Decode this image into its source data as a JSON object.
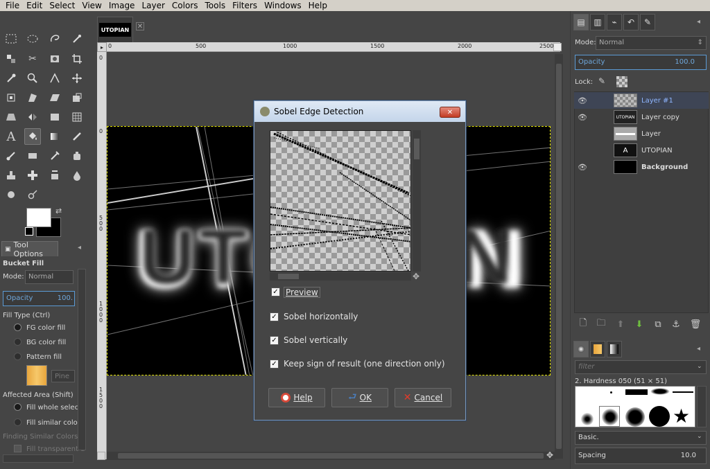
{
  "menubar": {
    "items": [
      "File",
      "Edit",
      "Select",
      "View",
      "Image",
      "Layer",
      "Colors",
      "Tools",
      "Filters",
      "Windows",
      "Help"
    ]
  },
  "image_tab": {
    "thumb_text": "UTOPIAN",
    "close": "✕"
  },
  "rulers": {
    "h_ticks": [
      "0",
      "500",
      "1000",
      "1500",
      "2000",
      "2500"
    ],
    "v_ticks": [
      "0",
      "500",
      "1000",
      "1500"
    ]
  },
  "canvas": {
    "image_text": "UTOPIAN",
    "bg_color": "#000000",
    "text_color": "#ffffff"
  },
  "tool_options": {
    "tab_label": "Tool Options",
    "tool_name": "Bucket Fill",
    "mode_label": "Mode:",
    "mode_value": "Normal",
    "opacity_label": "Opacity",
    "opacity_value": "100.",
    "fill_type_label": "Fill Type  (Ctrl)",
    "fill_fg": "FG color fill",
    "fill_bg": "BG color fill",
    "fill_pattern": "Pattern fill",
    "pattern_name": "Pine",
    "affected_label": "Affected Area  (Shift)",
    "affected_whole": "Fill whole selecti",
    "affected_similar": "Fill similar colors",
    "finding_label": "Finding Similar Colors",
    "fill_transparent": "Fill transparent a"
  },
  "layers_panel": {
    "mode_label": "Mode:",
    "mode_value": "Normal",
    "opacity_label": "Opacity",
    "opacity_value": "100.0",
    "lock_label": "Lock:",
    "layers": [
      {
        "name": "Layer #1",
        "visible": true,
        "selected": true
      },
      {
        "name": "Layer copy",
        "visible": true,
        "selected": false
      },
      {
        "name": "Layer",
        "visible": false,
        "selected": false
      },
      {
        "name": "UTOPIAN",
        "visible": false,
        "selected": false
      },
      {
        "name": "Background",
        "visible": true,
        "selected": false
      }
    ]
  },
  "brushes_panel": {
    "filter_placeholder": "filter",
    "brush_name": "2. Hardness 050 (51 × 51)",
    "preset_value": "Basic.",
    "spacing_label": "Spacing",
    "spacing_value": "10.0"
  },
  "dialog": {
    "title": "Sobel Edge Detection",
    "preview_label": "Preview",
    "sobel_h_label": "Sobel horizontally",
    "sobel_v_label": "Sobel vertically",
    "keep_sign_label": "Keep sign of result (one direction only)",
    "help_label": "Help",
    "ok_label": "OK",
    "cancel_label": "Cancel",
    "preview_checked": true,
    "sobel_h_checked": true,
    "sobel_v_checked": true,
    "keep_sign_checked": true
  },
  "colors": {
    "accent": "#5b9bd5",
    "selected_layer_text": "#8fb6ff"
  }
}
